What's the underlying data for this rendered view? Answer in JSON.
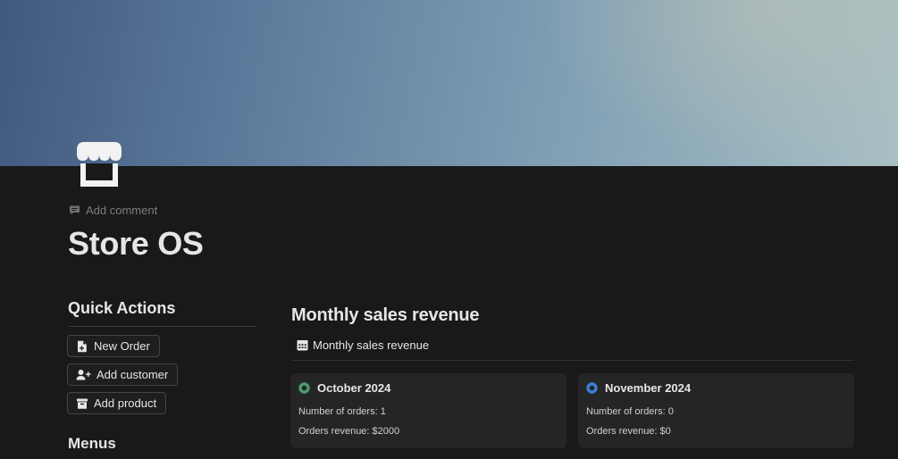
{
  "page": {
    "title": "Store OS",
    "add_comment": "Add comment"
  },
  "quick_actions": {
    "heading": "Quick Actions",
    "buttons": [
      {
        "label": "New Order",
        "icon": "file-plus-icon"
      },
      {
        "label": "Add customer",
        "icon": "user-plus-icon"
      },
      {
        "label": "Add product",
        "icon": "archive-box-icon"
      }
    ]
  },
  "menus": {
    "heading": "Menus"
  },
  "revenue": {
    "heading": "Monthly sales revenue",
    "view_tab": "Monthly sales revenue",
    "cards": [
      {
        "title": "October 2024",
        "status_color": "#4e9a6b",
        "orders": "Number of orders: 1",
        "revenue": "Orders revenue: $2000"
      },
      {
        "title": "November 2024",
        "status_color": "#3e7fd6",
        "orders": "Number of orders: 0",
        "revenue": "Orders revenue: $0"
      }
    ]
  },
  "colors": {
    "background": "#191919",
    "card": "#252525",
    "text": "#e6e6e6"
  }
}
